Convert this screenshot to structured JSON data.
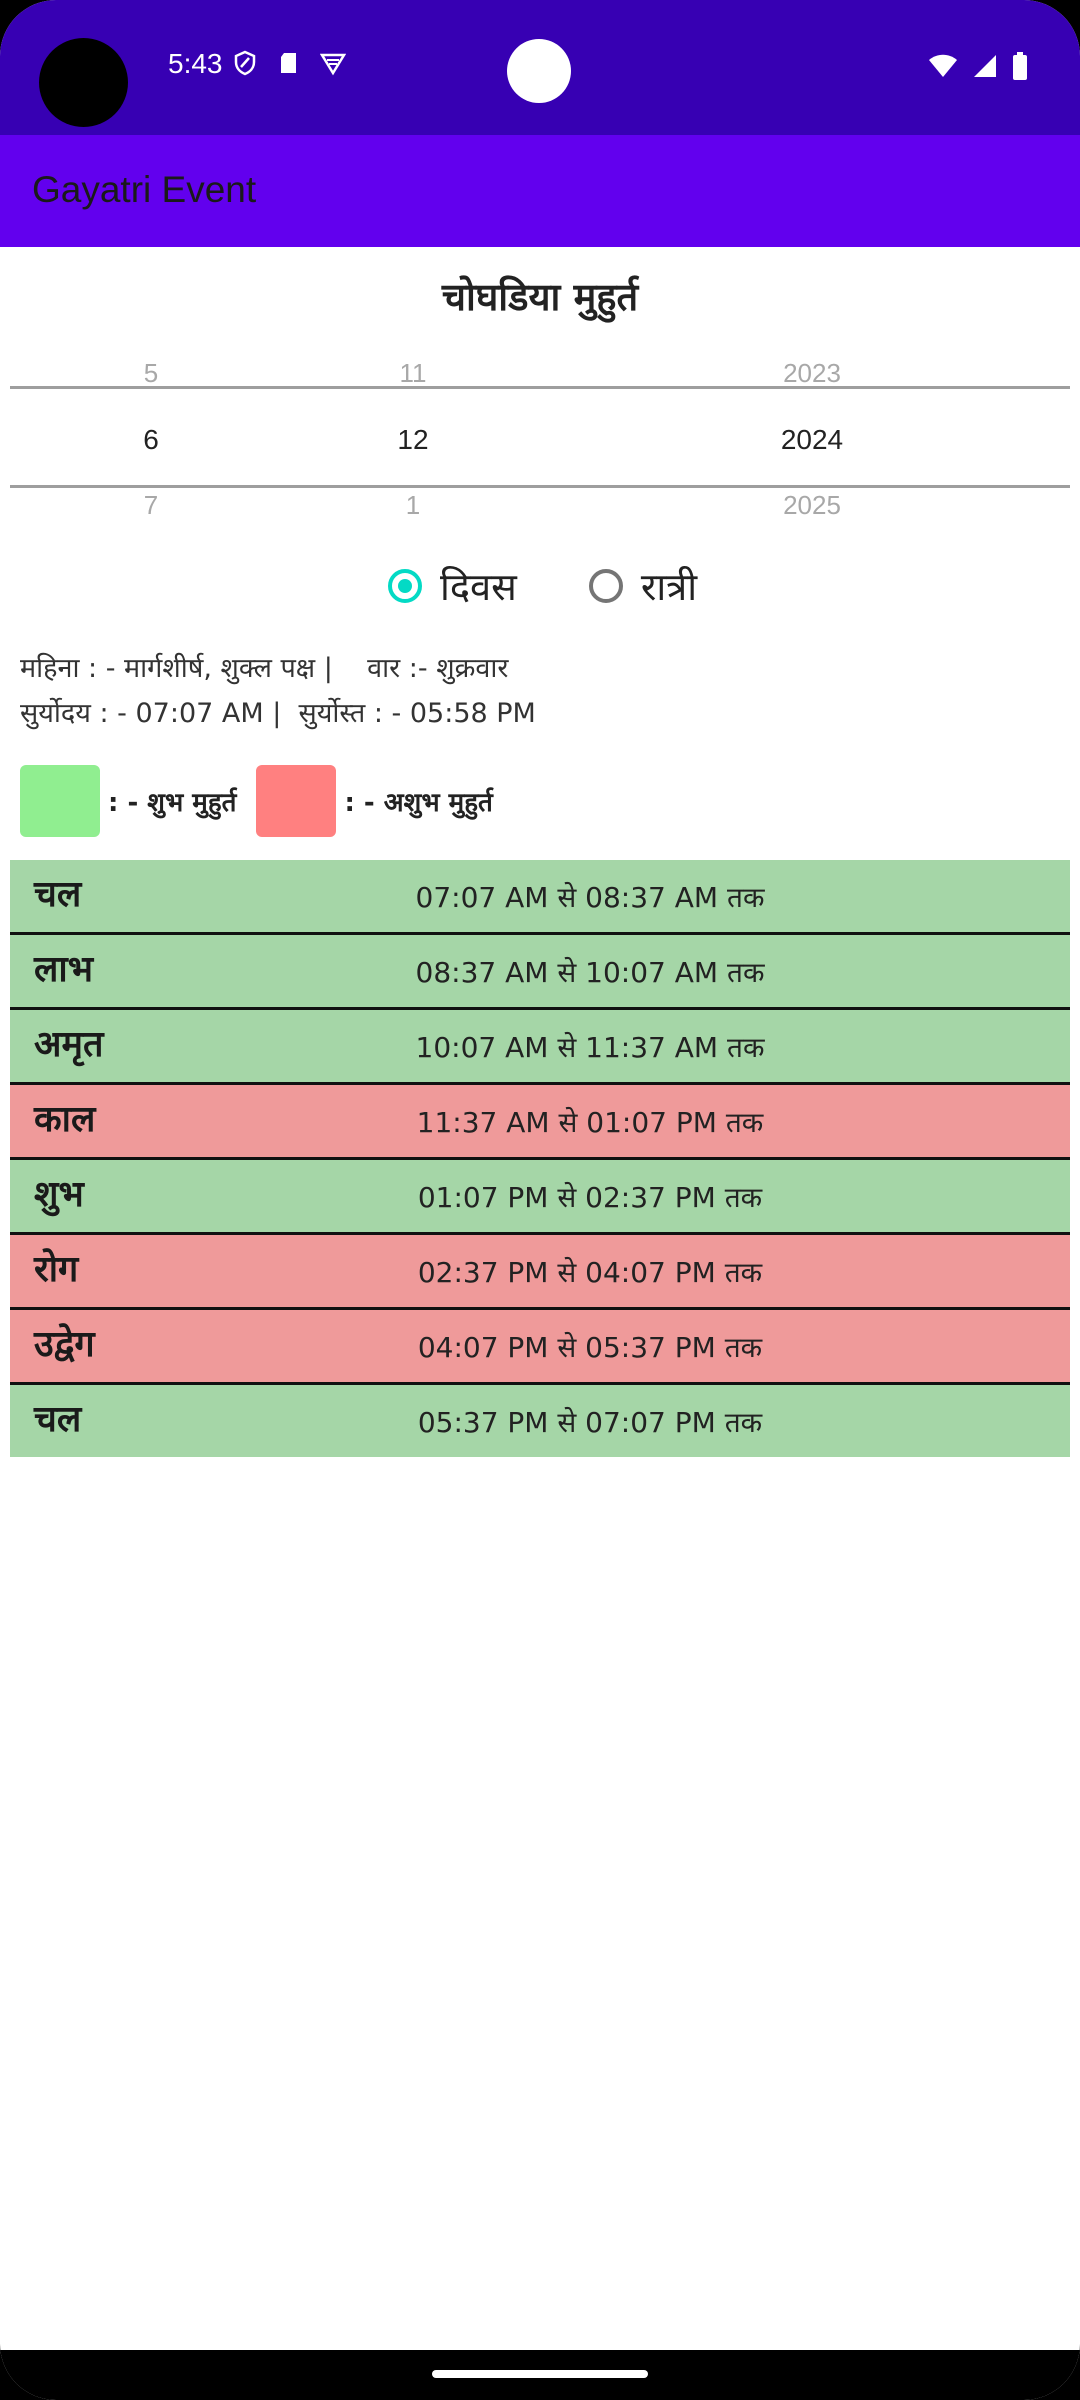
{
  "status_bar": {
    "time": "5:43",
    "background": "#3700B3",
    "left_icons": [
      "shield-icon",
      "sd-card-icon",
      "vpn-icon"
    ],
    "right_icons": [
      "wifi-icon",
      "signal-icon",
      "battery-icon"
    ]
  },
  "app_bar": {
    "title": "Gayatri Event",
    "background": "#6200EE"
  },
  "page": {
    "heading": "चोघडिया मुहुर्त"
  },
  "date_picker": {
    "day": {
      "prev": "5",
      "selected": "6",
      "next": "7"
    },
    "month": {
      "prev": "11",
      "selected": "12",
      "next": "1"
    },
    "year": {
      "prev": "2023",
      "selected": "2024",
      "next": "2025"
    }
  },
  "mode": {
    "options": [
      {
        "label": "दिवस",
        "checked": true
      },
      {
        "label": "रात्री",
        "checked": false
      }
    ],
    "accent": "#03DAC5"
  },
  "info": {
    "line1": "महिना : - मार्गशीर्ष, शुक्ल पक्ष |    वार :- शुक्रवार",
    "line2": "सुर्योदय : - 07:07 AM |  सुर्योस्त : - 05:58 PM"
  },
  "legend": {
    "good_label": ": - शुभ मुहुर्त",
    "good_color": "#90EE90",
    "bad_label": ": - अशुभ मुहुर्त",
    "bad_color": "#FF8080"
  },
  "slots": [
    {
      "name": "चल",
      "time": "07:07 AM से 08:37 AM तक",
      "type": "good"
    },
    {
      "name": "लाभ",
      "time": "08:37 AM से 10:07 AM तक",
      "type": "good"
    },
    {
      "name": "अमृत",
      "time": "10:07 AM से 11:37 AM तक",
      "type": "good"
    },
    {
      "name": "काल",
      "time": "11:37 AM से 01:07 PM तक",
      "type": "bad"
    },
    {
      "name": "शुभ",
      "time": "01:07 PM से 02:37 PM तक",
      "type": "good"
    },
    {
      "name": "रोग",
      "time": "02:37 PM से 04:07 PM तक",
      "type": "bad"
    },
    {
      "name": "उद्वेग",
      "time": "04:07 PM से 05:37 PM तक",
      "type": "bad"
    },
    {
      "name": "चल",
      "time": "05:37 PM से 07:07 PM तक",
      "type": "good"
    }
  ],
  "slot_colors": {
    "good": "#A5D6A7",
    "bad": "#EF9A9A"
  }
}
